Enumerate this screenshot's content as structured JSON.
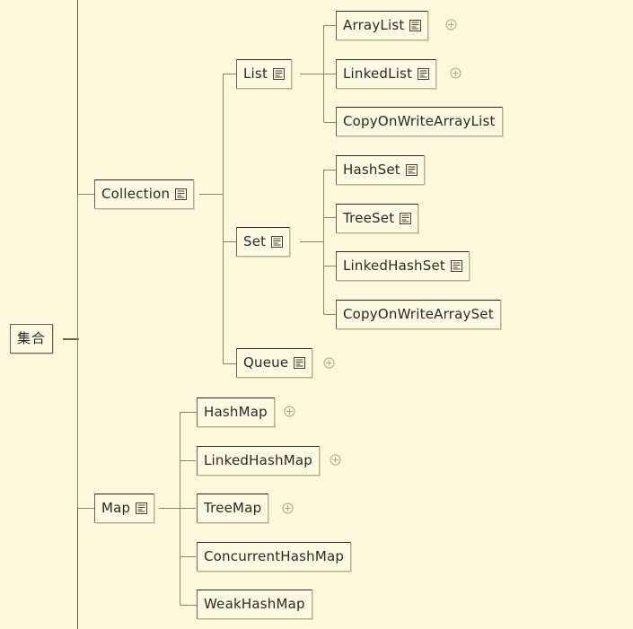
{
  "diagram": {
    "title": "Java Collections Framework mind map",
    "background_color": "#fdf8dc",
    "node_fill_color": "#fdf9e3",
    "line_color": "#8d8467",
    "text_color": "#2b2b24",
    "icons": {
      "note": "note-icon",
      "expand": "expand-plus-icon"
    }
  },
  "root": {
    "label": "集合",
    "has_note": false,
    "has_expand": false
  },
  "branches": [
    {
      "label": "Collection",
      "has_note": true,
      "has_expand": false,
      "children": [
        {
          "label": "List",
          "has_note": true,
          "has_expand": false,
          "children": [
            {
              "label": "ArrayList",
              "has_note": true,
              "has_expand": true
            },
            {
              "label": "LinkedList",
              "has_note": true,
              "has_expand": true
            },
            {
              "label": "CopyOnWriteArrayList",
              "has_note": false,
              "has_expand": false
            }
          ]
        },
        {
          "label": "Set",
          "has_note": true,
          "has_expand": false,
          "children": [
            {
              "label": "HashSet",
              "has_note": true,
              "has_expand": false
            },
            {
              "label": "TreeSet",
              "has_note": true,
              "has_expand": false
            },
            {
              "label": "LinkedHashSet",
              "has_note": true,
              "has_expand": false
            },
            {
              "label": "CopyOnWriteArraySet",
              "has_note": false,
              "has_expand": false
            }
          ]
        },
        {
          "label": "Queue",
          "has_note": true,
          "has_expand": true,
          "children": []
        }
      ]
    },
    {
      "label": "Map",
      "has_note": true,
      "has_expand": false,
      "children": [
        {
          "label": "HashMap",
          "has_note": false,
          "has_expand": true
        },
        {
          "label": "LinkedHashMap",
          "has_note": false,
          "has_expand": true
        },
        {
          "label": "TreeMap",
          "has_note": false,
          "has_expand": true
        },
        {
          "label": "ConcurrentHashMap",
          "has_note": false,
          "has_expand": false
        },
        {
          "label": "WeakHashMap",
          "has_note": false,
          "has_expand": false
        }
      ]
    }
  ],
  "nodes_flat": {
    "root": {
      "label": "集合"
    },
    "collection": {
      "label": "Collection"
    },
    "list": {
      "label": "List"
    },
    "arraylist": {
      "label": "ArrayList"
    },
    "linkedlist": {
      "label": "LinkedList"
    },
    "copyonwritearraylist": {
      "label": "CopyOnWriteArrayList"
    },
    "set": {
      "label": "Set"
    },
    "hashset": {
      "label": "HashSet"
    },
    "treeset": {
      "label": "TreeSet"
    },
    "linkedhashset": {
      "label": "LinkedHashSet"
    },
    "copyonwritearrayset": {
      "label": "CopyOnWriteArraySet"
    },
    "queue": {
      "label": "Queue"
    },
    "map": {
      "label": "Map"
    },
    "hashmap": {
      "label": "HashMap"
    },
    "linkedhashmap": {
      "label": "LinkedHashMap"
    },
    "treemap": {
      "label": "TreeMap"
    },
    "concurrenthashmap": {
      "label": "ConcurrentHashMap"
    },
    "weakhashmap": {
      "label": "WeakHashMap"
    }
  }
}
